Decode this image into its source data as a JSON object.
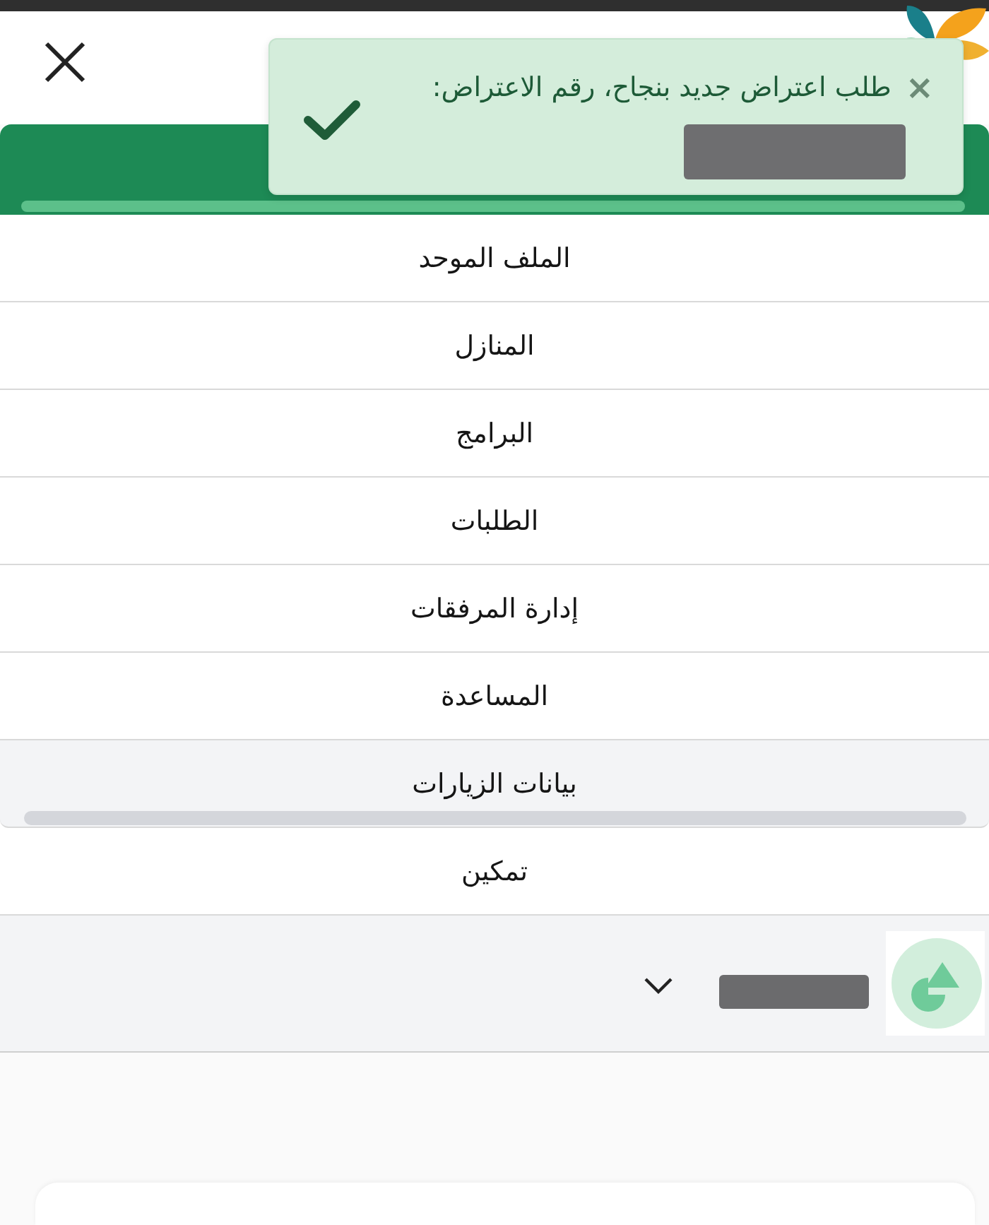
{
  "toast": {
    "close": "×",
    "message": "طلب اعتراض جديد بنجاح، رقم الاعتراض:"
  },
  "menu": {
    "items": [
      {
        "label": "الملف الموحد",
        "selected": false
      },
      {
        "label": "المنازل",
        "selected": false
      },
      {
        "label": "البرامج",
        "selected": false
      },
      {
        "label": "الطلبات",
        "selected": false
      },
      {
        "label": "إدارة المرفقات",
        "selected": false
      },
      {
        "label": "المساعدة",
        "selected": false
      },
      {
        "label": "بيانات الزيارات",
        "selected": true
      },
      {
        "label": "تمكين",
        "selected": false
      }
    ]
  }
}
